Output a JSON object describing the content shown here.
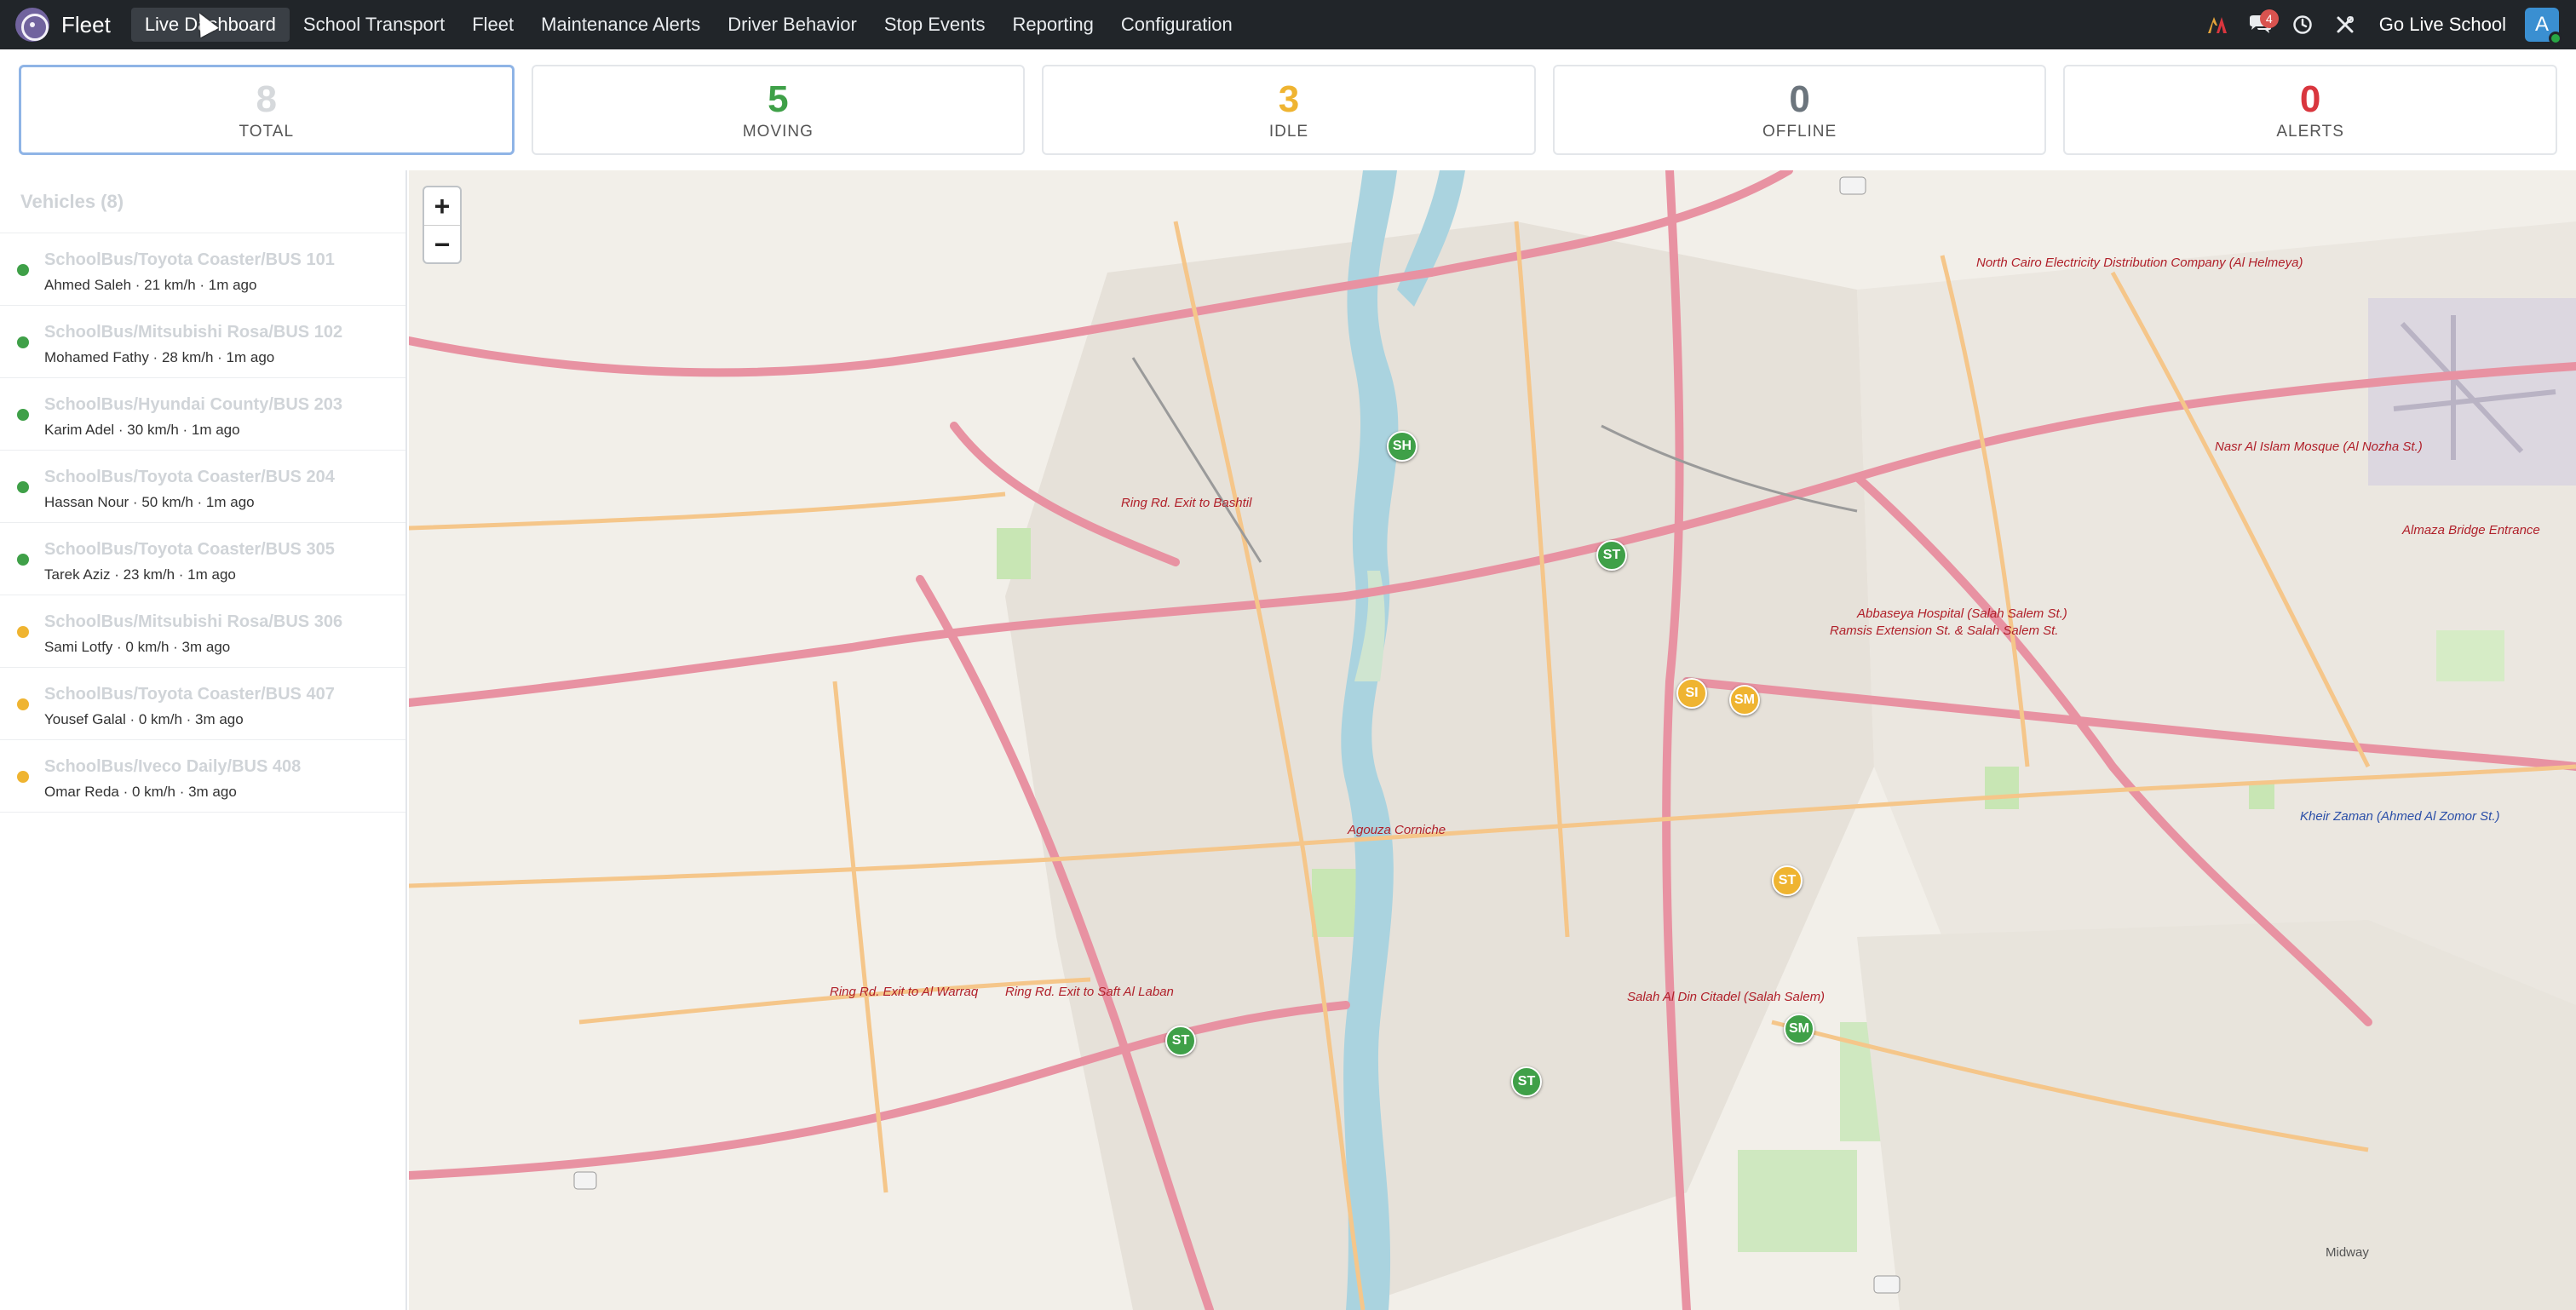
{
  "nav": {
    "brand": "Fleet",
    "menu": [
      {
        "label": "Live Dashboard",
        "active": true
      },
      {
        "label": "School Transport"
      },
      {
        "label": "Fleet"
      },
      {
        "label": "Maintenance Alerts"
      },
      {
        "label": "Driver Behavior"
      },
      {
        "label": "Stop Events"
      },
      {
        "label": "Reporting"
      },
      {
        "label": "Configuration"
      }
    ],
    "messages_badge": "4",
    "company": "Go Live School",
    "avatar_letter": "A"
  },
  "stats": [
    {
      "value": "8",
      "label": "TOTAL",
      "color": "#d6d9dc"
    },
    {
      "value": "5",
      "label": "MOVING",
      "color": "#3fa048"
    },
    {
      "value": "3",
      "label": "IDLE",
      "color": "#efb431"
    },
    {
      "value": "0",
      "label": "OFFLINE",
      "color": "#6c757d"
    },
    {
      "value": "0",
      "label": "ALERTS",
      "color": "#d9363e"
    }
  ],
  "sidebar": {
    "title": "Vehicles (8)",
    "vehicles": [
      {
        "name": "SchoolBus/Toyota Coaster/BUS 101",
        "detail": "Ahmed Saleh · 21 km/h · 1m ago",
        "status": "moving"
      },
      {
        "name": "SchoolBus/Mitsubishi Rosa/BUS 102",
        "detail": "Mohamed Fathy · 28 km/h · 1m ago",
        "status": "moving"
      },
      {
        "name": "SchoolBus/Hyundai County/BUS 203",
        "detail": "Karim Adel · 30 km/h · 1m ago",
        "status": "moving"
      },
      {
        "name": "SchoolBus/Toyota Coaster/BUS 204",
        "detail": "Hassan Nour · 50 km/h · 1m ago",
        "status": "moving"
      },
      {
        "name": "SchoolBus/Toyota Coaster/BUS 305",
        "detail": "Tarek Aziz · 23 km/h · 1m ago",
        "status": "moving"
      },
      {
        "name": "SchoolBus/Mitsubishi Rosa/BUS 306",
        "detail": "Sami Lotfy · 0 km/h · 3m ago",
        "status": "idle"
      },
      {
        "name": "SchoolBus/Toyota Coaster/BUS 407",
        "detail": "Yousef Galal · 0 km/h · 3m ago",
        "status": "idle"
      },
      {
        "name": "SchoolBus/Iveco Daily/BUS 408",
        "detail": "Omar Reda · 0 km/h · 3m ago",
        "status": "idle"
      }
    ]
  },
  "status_colors": {
    "moving": "#3fa048",
    "idle": "#efb431"
  },
  "map": {
    "zoom_in": "+",
    "zoom_out": "−",
    "markers": [
      {
        "label": "SH",
        "status": "moving"
      },
      {
        "label": "ST",
        "status": "moving"
      },
      {
        "label": "SI",
        "status": "idle"
      },
      {
        "label": "SM",
        "status": "idle"
      },
      {
        "label": "ST",
        "status": "idle"
      },
      {
        "label": "ST",
        "status": "moving"
      },
      {
        "label": "SM",
        "status": "moving"
      },
      {
        "label": "ST",
        "status": "moving"
      }
    ],
    "labels": [
      {
        "text": "Ring Rd. Exit to Bashtil",
        "kind": "poi"
      },
      {
        "text": "North Cairo Electricity Distribution Company (Al Helmeya)",
        "kind": "poi"
      },
      {
        "text": "Nasr Al Islam Mosque (Al Nozha St.)",
        "kind": "poi"
      },
      {
        "text": "Almaza Bridge Entrance",
        "kind": "poi"
      },
      {
        "text": "Abbaseya Hospital (Salah Salem St.)",
        "kind": "poi"
      },
      {
        "text": "Ramsis Extension St. & Salah Salem St.",
        "kind": "poi"
      },
      {
        "text": "Agouza Corniche",
        "kind": "poi"
      },
      {
        "text": "Ring Rd. Exit to Al Warraq",
        "kind": "poi"
      },
      {
        "text": "Ring Rd. Exit to Saft Al Laban",
        "kind": "poi"
      },
      {
        "text": "Salah Al Din Citadel (Salah Salem)",
        "kind": "poi"
      },
      {
        "text": "Kheir Zaman (Ahmed Al Zomor St.)",
        "kind": "poi-blue"
      },
      {
        "text": "Midway",
        "kind": "plain"
      }
    ]
  }
}
